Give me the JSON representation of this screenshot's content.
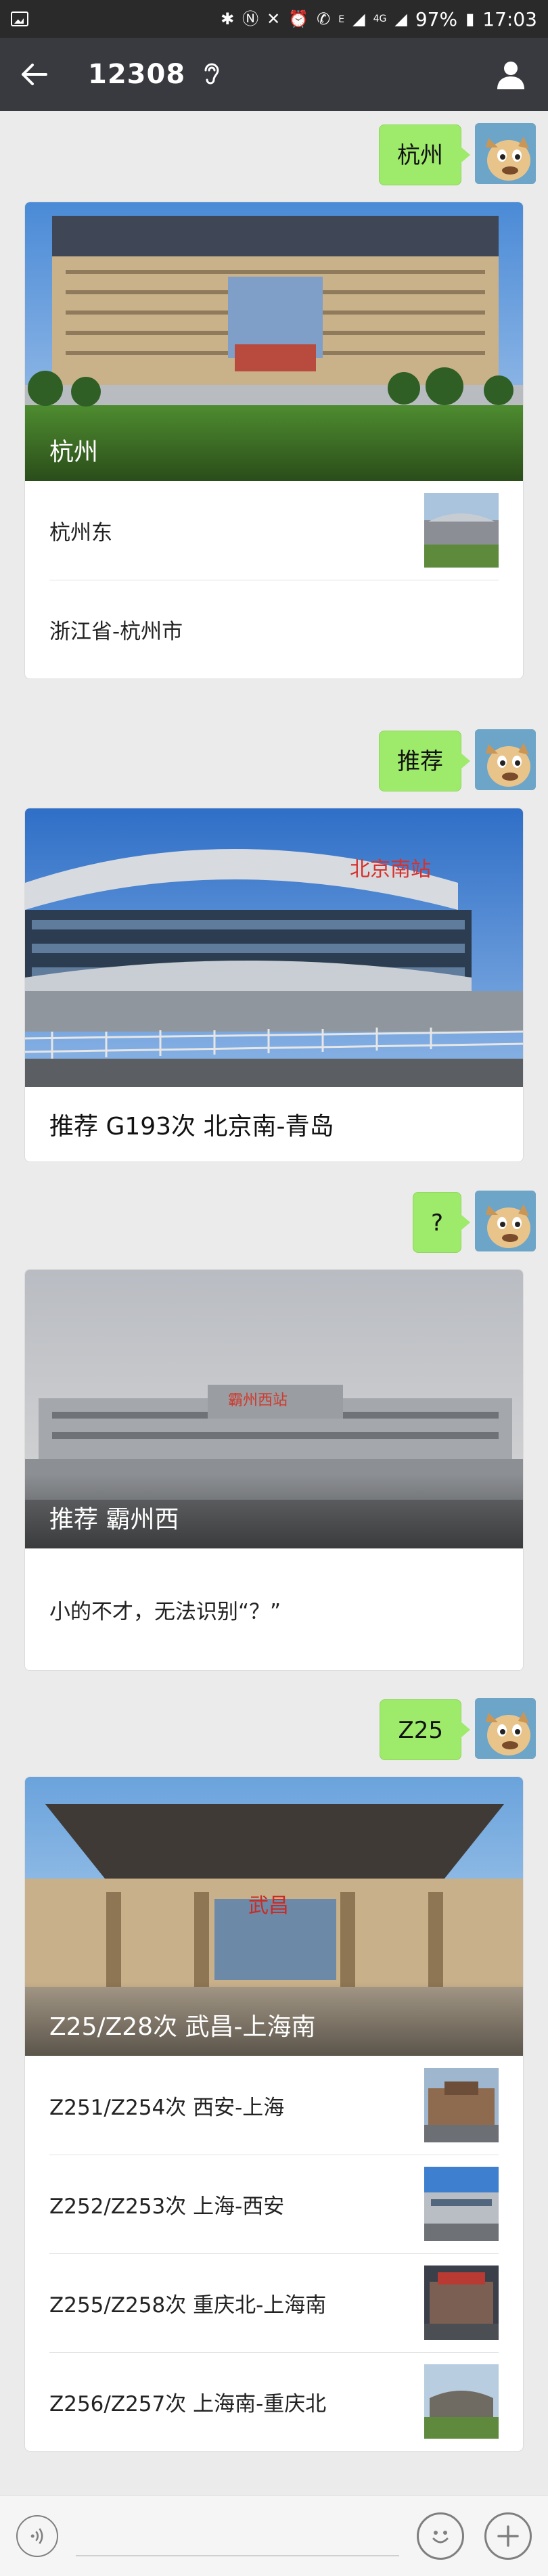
{
  "status_bar": {
    "icons": [
      "image-icon",
      "bluetooth-icon",
      "nfc-icon",
      "mute-icon",
      "alarm-icon",
      "phone-icon",
      "e-network-icon",
      "wifi-icon",
      "4g-signal-icon",
      "signal-icon",
      "battery-icon"
    ],
    "battery": "97%",
    "time": "17:03",
    "network_label": "E"
  },
  "header": {
    "title": "12308",
    "back_icon": "back-arrow-icon",
    "ear_icon": "earpiece-icon",
    "profile_icon": "person-icon"
  },
  "messages": [
    {
      "user_text": "杭州",
      "card": {
        "hero_caption": "杭州",
        "items": [
          {
            "label": "杭州东",
            "has_thumb": true
          },
          {
            "label": "浙江省-杭州市",
            "has_thumb": false
          }
        ]
      }
    },
    {
      "user_text": "推荐",
      "card": {
        "hero_sign": "北京南站",
        "title": "推荐 G193次 北京南-青岛"
      }
    },
    {
      "user_text": "?",
      "card": {
        "hero_caption": "推荐 霸州西",
        "hero_sign": "霸州西站",
        "text": "小的不才，无法识别“？”"
      }
    },
    {
      "user_text": "Z25",
      "card": {
        "hero_caption": "Z25/Z28次 武昌-上海南",
        "hero_sign": "武昌",
        "items": [
          {
            "label": "Z251/Z254次 西安-上海"
          },
          {
            "label": "Z252/Z253次 上海-西安"
          },
          {
            "label": "Z255/Z258次 重庆北-上海南"
          },
          {
            "label": "Z256/Z257次 上海南-重庆北"
          }
        ]
      }
    }
  ],
  "input_bar": {
    "voice_icon": "voice-icon",
    "emoji_icon": "emoji-icon",
    "add_icon": "plus-icon"
  },
  "colors": {
    "status_bar": "#2a2a2a",
    "title_bar": "#393a3f",
    "bubble": "#9eea6a",
    "background": "#ebebeb"
  }
}
